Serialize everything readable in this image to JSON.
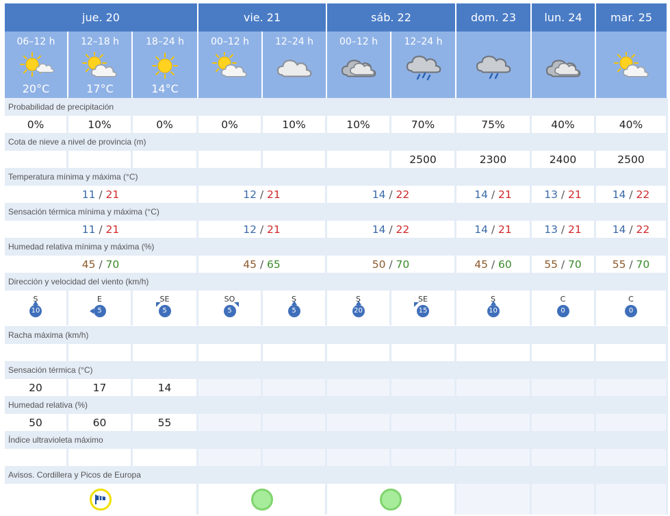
{
  "days": [
    {
      "label": "jue. 20"
    },
    {
      "label": "vie. 21"
    },
    {
      "label": "sáb. 22"
    },
    {
      "label": "dom. 23"
    },
    {
      "label": "lun. 24"
    },
    {
      "label": "mar. 25"
    }
  ],
  "periods": [
    {
      "label": "06–12 h",
      "icon": "sun-with-cloud-icon",
      "temp": "20°C"
    },
    {
      "label": "12–18 h",
      "icon": "sun-behind-cloud-icon",
      "temp": "17°C"
    },
    {
      "label": "18–24 h",
      "icon": "sun-icon",
      "temp": "14°C"
    },
    {
      "label": "00–12 h",
      "icon": "sun-behind-cloud-icon",
      "temp": ""
    },
    {
      "label": "12–24 h",
      "icon": "cloud-icon",
      "temp": ""
    },
    {
      "label": "00–12 h",
      "icon": "dark-cloud-icon",
      "temp": ""
    },
    {
      "label": "12–24 h",
      "icon": "storm-rain-icon",
      "temp": ""
    },
    {
      "label": "",
      "icon": "cloud-rain-icon",
      "temp": ""
    },
    {
      "label": "",
      "icon": "dark-cloud-icon",
      "temp": ""
    },
    {
      "label": "",
      "icon": "sun-behind-cloud-icon",
      "temp": ""
    }
  ],
  "rows": {
    "precip": {
      "label": "Probabilidad de precipitación",
      "values": [
        "0%",
        "10%",
        "0%",
        "0%",
        "10%",
        "10%",
        "70%",
        "75%",
        "40%",
        "40%"
      ]
    },
    "snow": {
      "label": "Cota de nieve a nivel de provincia (m)",
      "values": [
        "",
        "",
        "",
        "",
        "",
        "",
        "2500",
        "2300",
        "2400",
        "2500"
      ]
    },
    "temp": {
      "label": "Temperatura mínima y máxima (°C)",
      "values": [
        {
          "min": "11",
          "max": "21"
        },
        {
          "min": "12",
          "max": "21"
        },
        {
          "min": "14",
          "max": "22"
        },
        {
          "min": "14",
          "max": "21"
        },
        {
          "min": "13",
          "max": "21"
        },
        {
          "min": "14",
          "max": "22"
        }
      ]
    },
    "feels": {
      "label": "Sensación térmica mínima y máxima (°C)",
      "values": [
        {
          "min": "11",
          "max": "21"
        },
        {
          "min": "12",
          "max": "21"
        },
        {
          "min": "14",
          "max": "22"
        },
        {
          "min": "14",
          "max": "21"
        },
        {
          "min": "13",
          "max": "21"
        },
        {
          "min": "14",
          "max": "22"
        }
      ]
    },
    "humidity": {
      "label": "Humedad relativa mínima y máxima (%)",
      "values": [
        {
          "min": "45",
          "max": "70"
        },
        {
          "min": "45",
          "max": "65"
        },
        {
          "min": "50",
          "max": "70"
        },
        {
          "min": "45",
          "max": "60"
        },
        {
          "min": "55",
          "max": "70"
        },
        {
          "min": "55",
          "max": "70"
        }
      ]
    },
    "wind": {
      "label": "Dirección y velocidad del viento (km/h)",
      "values": [
        {
          "dir": "S",
          "speed": "10"
        },
        {
          "dir": "E",
          "speed": "5"
        },
        {
          "dir": "SE",
          "speed": "5"
        },
        {
          "dir": "SO",
          "speed": "5"
        },
        {
          "dir": "S",
          "speed": "5"
        },
        {
          "dir": "S",
          "speed": "20"
        },
        {
          "dir": "SE",
          "speed": "15"
        },
        {
          "dir": "S",
          "speed": "10"
        },
        {
          "dir": "C",
          "speed": "0"
        },
        {
          "dir": "C",
          "speed": "0"
        }
      ]
    },
    "gust": {
      "label": "Racha máxima (km/h)"
    },
    "feels_hourly": {
      "label": "Sensación térmica (°C)",
      "values": [
        "20",
        "17",
        "14"
      ]
    },
    "humidity_hourly": {
      "label": "Humedad relativa (%)",
      "values": [
        "50",
        "60",
        "55"
      ]
    },
    "uv": {
      "label": "Índice ultravioleta máximo"
    },
    "warnings": {
      "label": "Avisos. Cordillera y Picos de Europa",
      "values": [
        "wind-warning-icon",
        "no-warning-icon",
        "no-warning-icon"
      ]
    }
  },
  "colors": {
    "header_dark": "#4a7cc6",
    "header_light": "#8fb2e6",
    "label_bg": "#e4ecf6",
    "min_temp": "#3b6aa8",
    "max_temp": "#d02828",
    "min_humidity": "#8b5a2b",
    "max_humidity": "#3a8a2a",
    "wind_badge": "#3f6fba"
  }
}
